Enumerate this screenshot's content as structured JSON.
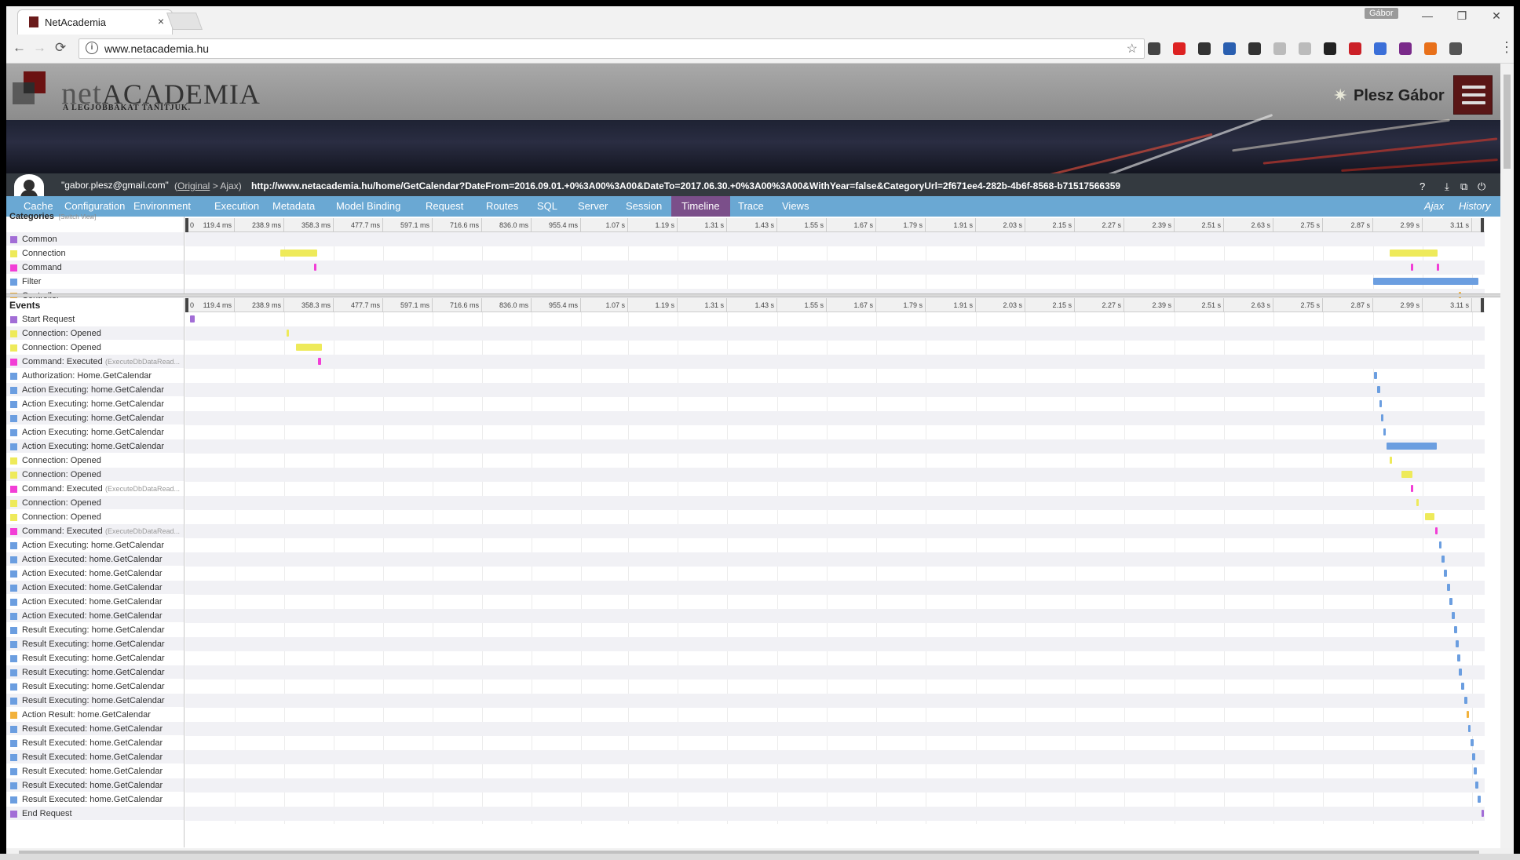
{
  "browser": {
    "tab_title": "NetAcademia",
    "tab_close": "×",
    "profile": "Gábor",
    "url": "www.netacademia.hu",
    "win_min": "—",
    "win_max": "❐",
    "win_close": "✕",
    "back": "←",
    "forward": "→",
    "reload": "⟳",
    "star": "☆",
    "menu": "⋮",
    "info": "i",
    "extension_icons": [
      {
        "name": "code-icon",
        "color": "#444"
      },
      {
        "name": "red-plus-icon",
        "color": "#d22"
      },
      {
        "name": "shield-icon",
        "color": "#333"
      },
      {
        "name": "screenshot-icon",
        "color": "#2a5fb0"
      },
      {
        "name": "sync-icon",
        "color": "#333"
      },
      {
        "name": "circle-icon",
        "color": "#bbb"
      },
      {
        "name": "puzzle-icon",
        "color": "#bbb"
      },
      {
        "name": "cursor-icon",
        "color": "#222"
      },
      {
        "name": "pinterest-icon",
        "color": "#cb2027"
      },
      {
        "name": "card-icon",
        "color": "#3b6fd8"
      },
      {
        "name": "onenote-icon",
        "color": "#7a2a8a"
      },
      {
        "name": "chart-icon",
        "color": "#e8701a"
      },
      {
        "name": "mail-icon",
        "color": "#555"
      }
    ]
  },
  "site": {
    "logo_net": "net",
    "logo_academia": "ACADEMIA",
    "tagline": "A LEGJOBBAKAT TANÍTJUK.",
    "user_name": "Plesz Gábor",
    "sun": "✷"
  },
  "glimpse": {
    "user": "\"gabor.plesz@gmail.com\"",
    "original": "Original",
    "ajax_crumb": "> Ajax)",
    "paren_open": "(",
    "request_url": "http://www.netacademia.hu/home/GetCalendar?DateFrom=2016.09.01.+0%3A00%3A00&DateTo=2017.06.30.+0%3A00%3A00&WithYear=false&CategoryUrl=2f671ee4-282b-4b6f-8568-b71517566359",
    "icons": [
      {
        "name": "help-icon",
        "glyph": "?"
      },
      {
        "name": "pin-icon",
        "glyph": "⤓"
      },
      {
        "name": "popout-icon",
        "glyph": "⧉"
      },
      {
        "name": "power-icon",
        "glyph": "⏻"
      }
    ],
    "tabs": [
      "Cache",
      "Configuration",
      "Environment",
      "Execution",
      "Metadata",
      "Model Binding",
      "Request",
      "Routes",
      "SQL",
      "Server",
      "Session",
      "Timeline",
      "Trace",
      "Views"
    ],
    "active_tab": "Timeline",
    "right_tabs": [
      "Ajax",
      "History"
    ]
  },
  "timeline": {
    "categories_title": "Categories",
    "switch_view": "[Switch View]",
    "events_title": "Events",
    "ticks": [
      "119.4 ms",
      "238.9 ms",
      "358.3 ms",
      "477.7 ms",
      "597.1 ms",
      "716.6 ms",
      "836.0 ms",
      "955.4 ms",
      "1.07 s",
      "1.19 s",
      "1.31 s",
      "1.43 s",
      "1.55 s",
      "1.67 s",
      "1.79 s",
      "1.91 s",
      "2.03 s",
      "2.15 s",
      "2.27 s",
      "2.39 s",
      "2.51 s",
      "2.63 s",
      "2.75 s",
      "2.87 s",
      "2.99 s",
      "3.11 s"
    ],
    "zero": "0",
    "total_ms": 3140,
    "colors": {
      "Common": "#a26dd6",
      "Connection": "#eeea5a",
      "Command": "#f23ed6",
      "Filter": "#6b9ee0",
      "Controller": "#f2b23c"
    },
    "categories": [
      {
        "name": "Common",
        "bars": []
      },
      {
        "name": "Connection",
        "bars": [
          [
            230,
            90
          ],
          [
            2910,
            115
          ]
        ]
      },
      {
        "name": "Command",
        "bars": [
          [
            312,
            6
          ],
          [
            2962,
            6
          ],
          [
            3024,
            6
          ]
        ]
      },
      {
        "name": "Filter",
        "bars": [
          [
            2870,
            255
          ]
        ]
      },
      {
        "name": "Controller",
        "bars": [
          [
            3078,
            6
          ]
        ]
      }
    ],
    "events": [
      {
        "label": "Start Request",
        "cat": "Common",
        "start": 12,
        "dur": 12
      },
      {
        "label": "Connection: Opened",
        "cat": "Connection",
        "start": 245,
        "dur": 6
      },
      {
        "label": "Connection: Opened",
        "cat": "Connection",
        "start": 268,
        "dur": 62
      },
      {
        "label": "Command: Executed",
        "sub": "(ExecuteDbDataRead...",
        "cat": "Command",
        "start": 320,
        "dur": 7
      },
      {
        "label": "Authorization: Home.GetCalendar",
        "cat": "Filter",
        "start": 2873,
        "dur": 8
      },
      {
        "label": "Action Executing: home.GetCalendar",
        "cat": "Filter",
        "start": 2880,
        "dur": 8
      },
      {
        "label": "Action Executing: home.GetCalendar",
        "cat": "Filter",
        "start": 2886,
        "dur": 6
      },
      {
        "label": "Action Executing: home.GetCalendar",
        "cat": "Filter",
        "start": 2890,
        "dur": 6
      },
      {
        "label": "Action Executing: home.GetCalendar",
        "cat": "Filter",
        "start": 2895,
        "dur": 6
      },
      {
        "label": "Action Executing: home.GetCalendar",
        "cat": "Filter",
        "start": 2902,
        "dur": 122
      },
      {
        "label": "Connection: Opened",
        "cat": "Connection",
        "start": 2910,
        "dur": 5
      },
      {
        "label": "Connection: Opened",
        "cat": "Connection",
        "start": 2938,
        "dur": 26
      },
      {
        "label": "Command: Executed",
        "sub": "(ExecuteDbDataRead...",
        "cat": "Command",
        "start": 2962,
        "dur": 5
      },
      {
        "label": "Connection: Opened",
        "cat": "Connection",
        "start": 2975,
        "dur": 5
      },
      {
        "label": "Connection: Opened",
        "cat": "Connection",
        "start": 2995,
        "dur": 22
      },
      {
        "label": "Command: Executed",
        "sub": "(ExecuteDbDataRead...",
        "cat": "Command",
        "start": 3020,
        "dur": 6
      },
      {
        "label": "Action Executing: home.GetCalendar",
        "cat": "Filter",
        "start": 3030,
        "dur": 6
      },
      {
        "label": "Action Executed: home.GetCalendar",
        "cat": "Filter",
        "start": 3036,
        "dur": 8
      },
      {
        "label": "Action Executed: home.GetCalendar",
        "cat": "Filter",
        "start": 3042,
        "dur": 8
      },
      {
        "label": "Action Executed: home.GetCalendar",
        "cat": "Filter",
        "start": 3048,
        "dur": 8
      },
      {
        "label": "Action Executed: home.GetCalendar",
        "cat": "Filter",
        "start": 3054,
        "dur": 8
      },
      {
        "label": "Action Executed: home.GetCalendar",
        "cat": "Filter",
        "start": 3060,
        "dur": 8
      },
      {
        "label": "Result Executing: home.GetCalendar",
        "cat": "Filter",
        "start": 3066,
        "dur": 8
      },
      {
        "label": "Result Executing: home.GetCalendar",
        "cat": "Filter",
        "start": 3070,
        "dur": 8
      },
      {
        "label": "Result Executing: home.GetCalendar",
        "cat": "Filter",
        "start": 3074,
        "dur": 8
      },
      {
        "label": "Result Executing: home.GetCalendar",
        "cat": "Filter",
        "start": 3078,
        "dur": 8
      },
      {
        "label": "Result Executing: home.GetCalendar",
        "cat": "Filter",
        "start": 3084,
        "dur": 8
      },
      {
        "label": "Result Executing: home.GetCalendar",
        "cat": "Filter",
        "start": 3090,
        "dur": 8
      },
      {
        "label": "Action Result: home.GetCalendar",
        "cat": "Controller",
        "start": 3096,
        "dur": 6
      },
      {
        "label": "Result Executed: home.GetCalendar",
        "cat": "Filter",
        "start": 3100,
        "dur": 5
      },
      {
        "label": "Result Executed: home.GetCalendar",
        "cat": "Filter",
        "start": 3106,
        "dur": 8
      },
      {
        "label": "Result Executed: home.GetCalendar",
        "cat": "Filter",
        "start": 3110,
        "dur": 8
      },
      {
        "label": "Result Executed: home.GetCalendar",
        "cat": "Filter",
        "start": 3114,
        "dur": 8
      },
      {
        "label": "Result Executed: home.GetCalendar",
        "cat": "Filter",
        "start": 3118,
        "dur": 8
      },
      {
        "label": "Result Executed: home.GetCalendar",
        "cat": "Filter",
        "start": 3122,
        "dur": 8
      },
      {
        "label": "End Request",
        "cat": "Common",
        "start": 3132,
        "dur": 4
      }
    ]
  }
}
